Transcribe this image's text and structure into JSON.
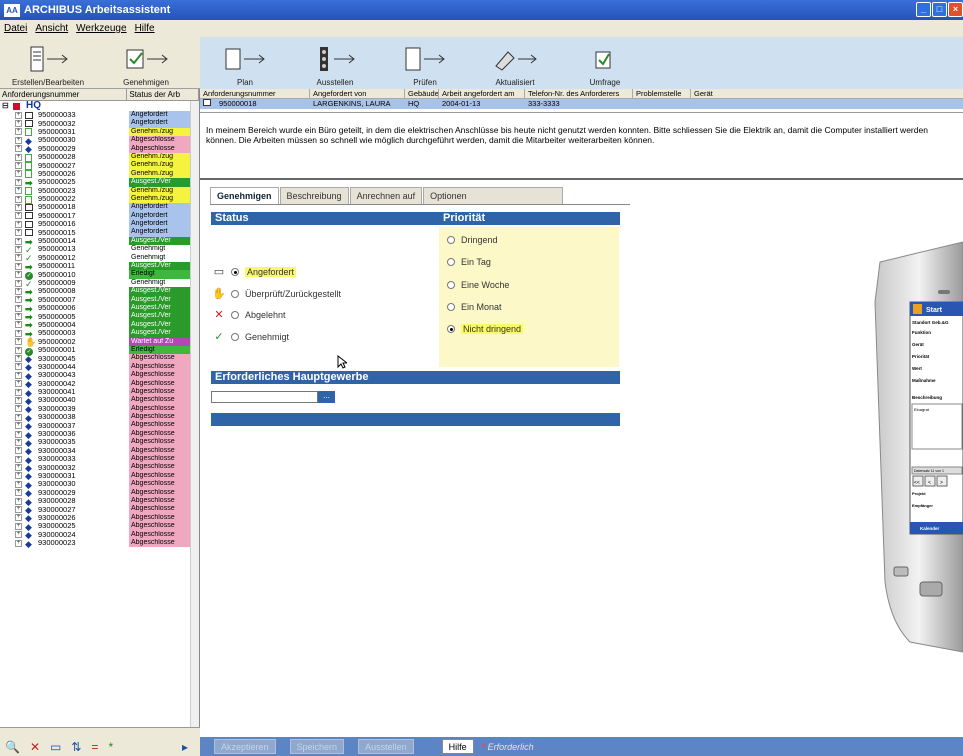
{
  "app": {
    "title": "ARCHIBUS Arbeitsassistent",
    "logo": "AA"
  },
  "menu": [
    "Datei",
    "Ansicht",
    "Werkzeuge",
    "Hilfe"
  ],
  "toolbar_left": [
    "Erstellen/Bearbeiten",
    "Genehmigen"
  ],
  "toolbar_right": [
    "Plan",
    "Ausstellen",
    "Prüfen",
    "Aktualisiert",
    "Umfrage"
  ],
  "tree": {
    "headers": [
      "Anforderungsnummer",
      "Status der Arb"
    ],
    "root": "HQ",
    "rows": [
      {
        "num": "950000033",
        "status": "Angefordert",
        "color": "#a9c4ec",
        "icon": "box"
      },
      {
        "num": "950000032",
        "status": "Angefordert",
        "color": "#a9c4ec",
        "icon": "box"
      },
      {
        "num": "950000031",
        "status": "Genehm./zug",
        "color": "#f4f440",
        "icon": "doc"
      },
      {
        "num": "950000030",
        "status": "Abgeschlosse",
        "color": "#f0a8c0",
        "icon": "diamond"
      },
      {
        "num": "950000029",
        "status": "Abgeschlosse",
        "color": "#f0a8c0",
        "icon": "diamond"
      },
      {
        "num": "950000028",
        "status": "Genehm./zug",
        "color": "#f4f440",
        "icon": "doc"
      },
      {
        "num": "950000027",
        "status": "Genehm./zug",
        "color": "#f4f440",
        "icon": "doc"
      },
      {
        "num": "950000026",
        "status": "Genehm./zug",
        "color": "#f4f440",
        "icon": "doc"
      },
      {
        "num": "950000025",
        "status": "Ausgest./Ver",
        "color": "#2a9a2a",
        "icon": "arrow"
      },
      {
        "num": "950000023",
        "status": "Genehm./zug",
        "color": "#f4f440",
        "icon": "doc"
      },
      {
        "num": "950000022",
        "status": "Genehm./zug",
        "color": "#f4f440",
        "icon": "doc"
      },
      {
        "num": "950000018",
        "status": "Angefordert",
        "color": "#a9c4ec",
        "icon": "box"
      },
      {
        "num": "950000017",
        "status": "Angefordert",
        "color": "#a9c4ec",
        "icon": "box"
      },
      {
        "num": "950000016",
        "status": "Angefordert",
        "color": "#a9c4ec",
        "icon": "box"
      },
      {
        "num": "950000015",
        "status": "Angefordert",
        "color": "#a9c4ec",
        "icon": "box"
      },
      {
        "num": "950000014",
        "status": "Ausgest./Ver",
        "color": "#2a9a2a",
        "icon": "arrow"
      },
      {
        "num": "950000013",
        "status": "Genehmigt",
        "color": "#ffffff",
        "icon": "check"
      },
      {
        "num": "950000012",
        "status": "Genehmigt",
        "color": "#ffffff",
        "icon": "check"
      },
      {
        "num": "950000011",
        "status": "Ausgest./Ver",
        "color": "#2a9a2a",
        "icon": "arrow"
      },
      {
        "num": "950000010",
        "status": "Erledigt",
        "color": "#3cb83c",
        "icon": "done"
      },
      {
        "num": "950000009",
        "status": "Genehmigt",
        "color": "#ffffff",
        "icon": "check"
      },
      {
        "num": "950000008",
        "status": "Ausgest./Ver",
        "color": "#2a9a2a",
        "icon": "arrow"
      },
      {
        "num": "950000007",
        "status": "Ausgest./Ver",
        "color": "#2a9a2a",
        "icon": "arrow"
      },
      {
        "num": "950000006",
        "status": "Ausgest./Ver",
        "color": "#2a9a2a",
        "icon": "arrow"
      },
      {
        "num": "950000005",
        "status": "Ausgest./Ver",
        "color": "#2a9a2a",
        "icon": "arrow"
      },
      {
        "num": "950000004",
        "status": "Ausgest./Ver",
        "color": "#2a9a2a",
        "icon": "arrow"
      },
      {
        "num": "950000003",
        "status": "Ausgest./Ver",
        "color": "#2a9a2a",
        "icon": "arrow"
      },
      {
        "num": "950000002",
        "status": "Wartet auf Zu",
        "color": "#b04ab0",
        "icon": "hand"
      },
      {
        "num": "950000001",
        "status": "Erledigt",
        "color": "#3cb83c",
        "icon": "done"
      },
      {
        "num": "930000045",
        "status": "Abgeschlosse",
        "color": "#f0a8c0",
        "icon": "diamond"
      },
      {
        "num": "930000044",
        "status": "Abgeschlosse",
        "color": "#f0a8c0",
        "icon": "diamond"
      },
      {
        "num": "930000043",
        "status": "Abgeschlosse",
        "color": "#f0a8c0",
        "icon": "diamond"
      },
      {
        "num": "930000042",
        "status": "Abgeschlosse",
        "color": "#f0a8c0",
        "icon": "diamond"
      },
      {
        "num": "930000041",
        "status": "Abgeschlosse",
        "color": "#f0a8c0",
        "icon": "diamond"
      },
      {
        "num": "930000040",
        "status": "Abgeschlosse",
        "color": "#f0a8c0",
        "icon": "diamond"
      },
      {
        "num": "930000039",
        "status": "Abgeschlosse",
        "color": "#f0a8c0",
        "icon": "diamond"
      },
      {
        "num": "930000038",
        "status": "Abgeschlosse",
        "color": "#f0a8c0",
        "icon": "diamond"
      },
      {
        "num": "930000037",
        "status": "Abgeschlosse",
        "color": "#f0a8c0",
        "icon": "diamond"
      },
      {
        "num": "930000036",
        "status": "Abgeschlosse",
        "color": "#f0a8c0",
        "icon": "diamond"
      },
      {
        "num": "930000035",
        "status": "Abgeschlosse",
        "color": "#f0a8c0",
        "icon": "diamond"
      },
      {
        "num": "930000034",
        "status": "Abgeschlosse",
        "color": "#f0a8c0",
        "icon": "diamond"
      },
      {
        "num": "930000033",
        "status": "Abgeschlosse",
        "color": "#f0a8c0",
        "icon": "diamond"
      },
      {
        "num": "930000032",
        "status": "Abgeschlosse",
        "color": "#f0a8c0",
        "icon": "diamond"
      },
      {
        "num": "930000031",
        "status": "Abgeschlosse",
        "color": "#f0a8c0",
        "icon": "diamond"
      },
      {
        "num": "930000030",
        "status": "Abgeschlosse",
        "color": "#f0a8c0",
        "icon": "diamond"
      },
      {
        "num": "930000029",
        "status": "Abgeschlosse",
        "color": "#f0a8c0",
        "icon": "diamond"
      },
      {
        "num": "930000028",
        "status": "Abgeschlosse",
        "color": "#f0a8c0",
        "icon": "diamond"
      },
      {
        "num": "930000027",
        "status": "Abgeschlosse",
        "color": "#f0a8c0",
        "icon": "diamond"
      },
      {
        "num": "930000026",
        "status": "Abgeschlosse",
        "color": "#f0a8c0",
        "icon": "diamond"
      },
      {
        "num": "930000025",
        "status": "Abgeschlosse",
        "color": "#f0a8c0",
        "icon": "diamond"
      },
      {
        "num": "930000024",
        "status": "Abgeschlosse",
        "color": "#f0a8c0",
        "icon": "diamond"
      },
      {
        "num": "930000023",
        "status": "Abgeschlosse",
        "color": "#f0a8c0",
        "icon": "diamond"
      }
    ]
  },
  "request_table": {
    "headers": [
      "Anforderungsnummer",
      "Angefordert von",
      "Gebäude",
      "Arbeit angefordert am",
      "Telefon-Nr. des Anforderers",
      "Problemstelle",
      "Gerät"
    ],
    "row": [
      "950000018",
      "LARGENKINS, LAURA",
      "HQ",
      "2004-01-13",
      "333-3333",
      "",
      ""
    ]
  },
  "description": "In meinem Bereich wurde ein Büro geteilt, in dem die elektrischen Anschlüsse bis heute nicht genutzt werden konnten. Bitte schliessen Sie die Elektrik an, damit die Computer installiert werden können. Die Arbeiten müssen so schnell wie möglich durchgeführt werden, damit die Mitarbeiter weiterarbeiten können.",
  "tabs": [
    "Genehmigen",
    "Beschreibung",
    "Anrechnen auf",
    "Optionen"
  ],
  "status": {
    "title": "Status",
    "options": [
      "Angefordert",
      "Überprüft/Zurückgestellt",
      "Abgelehnt",
      "Genehmigt"
    ],
    "selected": "Angefordert"
  },
  "priority": {
    "title": "Priorität",
    "options": [
      "Dringend",
      "Ein Tag",
      "Eine Woche",
      "Ein Monat",
      "Nicht dringend"
    ],
    "selected": "Nicht dringend"
  },
  "trade": {
    "title": "Erforderliches Hauptgewerbe",
    "value": "",
    "button": "..."
  },
  "bottom": {
    "buttons": [
      "Akzeptieren",
      "Speichern",
      "Ausstellen"
    ],
    "help": "Hilfe",
    "required": "Erforderlich"
  },
  "device": {
    "start": "Start",
    "lines": [
      "Standort Geb.&G",
      "Funktion",
      "Gerät",
      "Priorität",
      "Wert",
      "Maßnahme",
      "Beschreibung"
    ],
    "memo": "Elnagrat",
    "record": "Datensatz 11 von 1",
    "nav": [
      "<<",
      "<",
      ">"
    ],
    "fields": [
      "Projekt",
      "Empfänger"
    ],
    "calendar": "Kalender"
  },
  "colors": {
    "accent": "#2f64a8",
    "highlight": "#fafa66",
    "priority_bg": "#fdf8c8"
  }
}
